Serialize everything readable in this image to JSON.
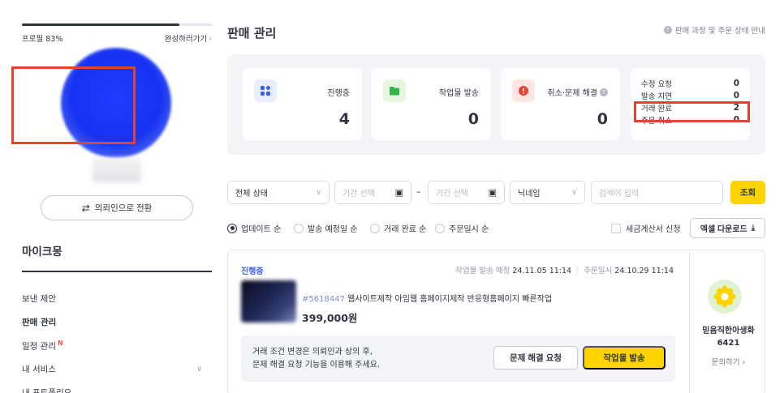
{
  "sidebar": {
    "profile_label": "프로필 83%",
    "profile_progress": 0.83,
    "complete_link": "완성하러가기",
    "switch_button": "의뢰인으로 전환",
    "brand_name": "마이크몽",
    "menu": [
      {
        "label": "보낸 제안",
        "active": false
      },
      {
        "label": "판매 관리",
        "active": true
      },
      {
        "label": "일정 관리",
        "active": false,
        "badge": "N"
      },
      {
        "label": "내 서비스",
        "active": false
      },
      {
        "label": "내 포트폴리오",
        "active": false
      }
    ]
  },
  "main": {
    "title": "판매 관리",
    "guide_link": "판매 과정 및 주문 상태 안내",
    "status_cards": [
      {
        "label": "진행중",
        "value": "4",
        "icon": "grid-icon",
        "icon_bg": "#e8eefc",
        "icon_color": "#3c61e6"
      },
      {
        "label": "작업물 발송",
        "value": "0",
        "icon": "folder-icon",
        "icon_bg": "#e6f6e0",
        "icon_color": "#36b24a"
      },
      {
        "label": "취소·문제 해결",
        "value": "0",
        "icon": "alert-icon",
        "icon_bg": "#fde6e4",
        "icon_color": "#e8412f"
      }
    ],
    "status_list": [
      {
        "label": "수정 요청",
        "value": "0"
      },
      {
        "label": "발송 지연",
        "value": "0"
      },
      {
        "label": "거래 완료",
        "value": "2"
      },
      {
        "label": "주문 취소",
        "value": "0"
      }
    ],
    "filters": {
      "status_select": "전체 상태",
      "date_start_placeholder": "기간 선택",
      "date_end_placeholder": "기간 선택",
      "date_separator": "–",
      "nickname_select": "닉네임",
      "search_placeholder": "검색어 입력",
      "search_button": "조회"
    },
    "sort_options": [
      {
        "label": "업데이트 순",
        "selected": true
      },
      {
        "label": "발송 예정일 순",
        "selected": false
      },
      {
        "label": "거래 완료 순",
        "selected": false
      },
      {
        "label": "주문일시 순",
        "selected": false
      }
    ],
    "tax_invoice_label": "세금계산서 신청",
    "excel_button": "엑셀 다운로드",
    "order": {
      "status": "진행중",
      "delivery_label": "작업물 발송 예정",
      "delivery_date": "24.11.05 11:14",
      "order_label": "주문일시",
      "order_date": "24.10.29 11:14",
      "order_no": "#5618447",
      "title": "웹사이트제작 아임웹 홈페이지제작 반응형홈페이지 빠른작업",
      "price": "399,000원",
      "notice_line1": "거래 조건 변경은 의뢰인과 상의 후,",
      "notice_line2": "문제 해결 요청 기능을 이용해 주세요.",
      "problem_button": "문제 해결 요청",
      "deliver_button": "작업물 발송",
      "buyer_name_line1": "믿음직한아생화",
      "buyer_name_line2": "6421",
      "buyer_contact": "문의하기"
    }
  },
  "colors": {
    "accent_yellow": "#ffd400",
    "highlight_red": "#e8412f",
    "status_blue": "#3c61e6"
  }
}
